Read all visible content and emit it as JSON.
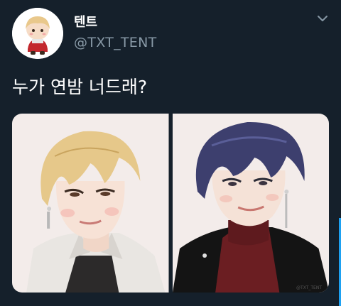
{
  "tweet": {
    "display_name": "텐트",
    "handle": "@TXT_TENT",
    "text": "누가 연밤 너드래?"
  },
  "media": {
    "watermark": "@TXT_TENT"
  },
  "icons": {
    "avatar": "chibi-avatar-icon",
    "menu": "chevron-down-icon"
  },
  "colors": {
    "background": "#15202b",
    "handle": "#8899a6",
    "accent": "#1da1f2"
  }
}
